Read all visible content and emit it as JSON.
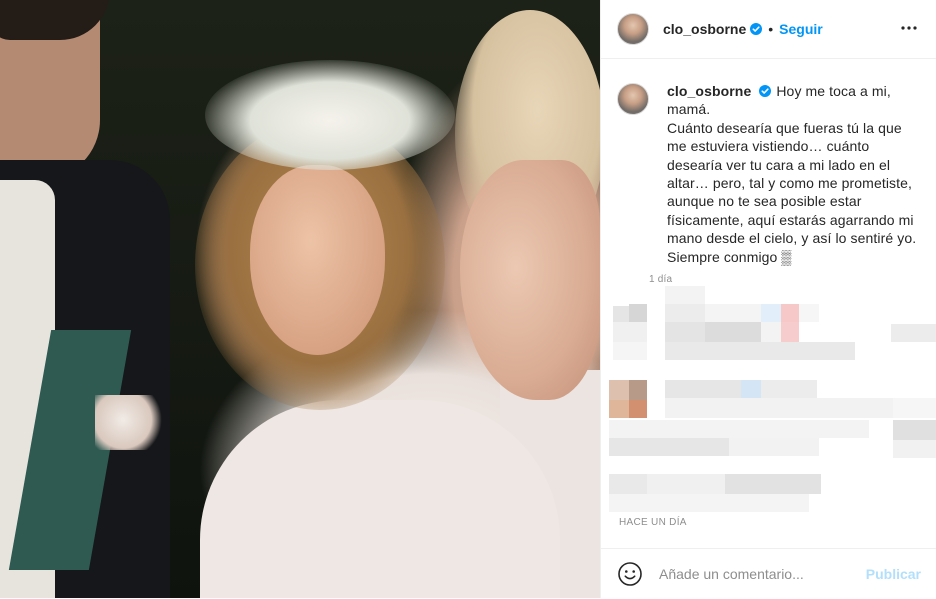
{
  "post": {
    "author": "clo_osborne",
    "follow_label": "Seguir",
    "separator": "•",
    "verified_icon": "verified-badge-icon",
    "more_icon": "more-options-icon"
  },
  "caption": {
    "author": "clo_osborne",
    "text": "Hoy me toca a mi, mamá.\nCuánto desearía que fueras tú la que me estuviera vistiendo… cuánto desearía ver tu cara a mi lado en el altar… pero, tal y como me prometiste, aunque no te sea posible estar físicamente, aquí estarás agarrando mi mano desde el cielo, y así lo sentiré yo. Siempre conmigo ▒",
    "time": "1 día"
  },
  "post_time": "HACE UN DÍA",
  "comment_box": {
    "placeholder": "Añade un comentario...",
    "publish_label": "Publicar",
    "emoji_icon": "emoji-icon"
  },
  "colors": {
    "accent": "#0095f6",
    "publish_disabled": "#b2dffc",
    "muted": "#8e8e8e"
  }
}
